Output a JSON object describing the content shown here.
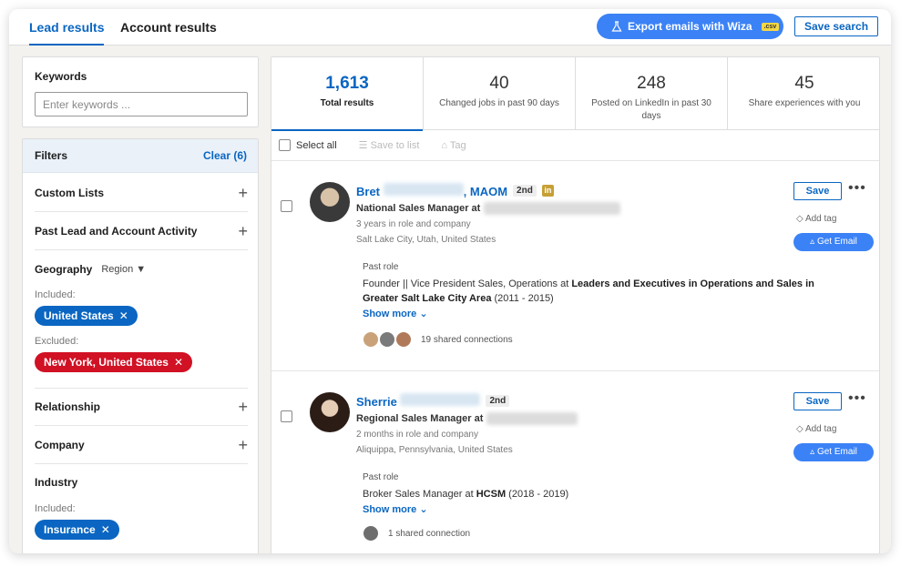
{
  "tabs": [
    {
      "label": "Lead results",
      "active": true
    },
    {
      "label": "Account results",
      "active": false
    }
  ],
  "header": {
    "export_label": "Export emails with Wiza",
    "csv_badge": ".csv",
    "save_search_label": "Save search"
  },
  "keywords": {
    "label": "Keywords",
    "placeholder": "Enter keywords ..."
  },
  "filters": {
    "title": "Filters",
    "clear_label": "Clear (6)",
    "custom_lists": "Custom Lists",
    "past_activity": "Past Lead and Account Activity",
    "geography": {
      "label": "Geography",
      "region_select": "Region",
      "included_label": "Included:",
      "included": "United States",
      "excluded_label": "Excluded:",
      "excluded": "New York, United States"
    },
    "relationship": "Relationship",
    "company": "Company",
    "industry": {
      "label": "Industry",
      "included_label": "Included:",
      "included": "Insurance"
    }
  },
  "stats": [
    {
      "num": "1,613",
      "desc": "Total results",
      "active": true
    },
    {
      "num": "40",
      "desc": "Changed jobs in past 90 days",
      "active": false
    },
    {
      "num": "248",
      "desc": "Posted on LinkedIn in past 30 days",
      "active": false
    },
    {
      "num": "45",
      "desc": "Share experiences with you",
      "active": false
    }
  ],
  "actions": {
    "select_all": "Select all",
    "save_to_list": "Save to list",
    "tag": "Tag"
  },
  "leads": [
    {
      "first_name": "Bret",
      "suffix": ", MAOM",
      "degree": "2nd",
      "title": "National Sales Manager at",
      "tenure": "3 years in role and company",
      "location": "Salt Lake City, Utah, United States",
      "past_role_label": "Past role",
      "past_role_prefix": "Founder || Vice President Sales, Operations at ",
      "past_role_company": "Leaders and Executives in Operations and Sales in Greater Salt Lake City Area",
      "past_role_dates": " (2011 - 2015)",
      "show_more": "Show more",
      "shared": "19 shared connections",
      "save": "Save",
      "add_tag": "Add tag",
      "get_email": "Get Email"
    },
    {
      "first_name": "Sherrie",
      "suffix": "",
      "degree": "2nd",
      "title": "Regional Sales Manager at",
      "tenure": "2 months in role and company",
      "location": "Aliquippa, Pennsylvania, United States",
      "past_role_label": "Past role",
      "past_role_prefix": "Broker Sales Manager at ",
      "past_role_company": "HCSM",
      "past_role_dates": " (2018 - 2019)",
      "show_more": "Show more",
      "shared": "1 shared connection",
      "save": "Save",
      "add_tag": "Add tag",
      "get_email": "Get Email"
    }
  ],
  "colors": {
    "accent": "#0a66c2",
    "exclude": "#d11124",
    "wiza": "#3b82f6"
  }
}
